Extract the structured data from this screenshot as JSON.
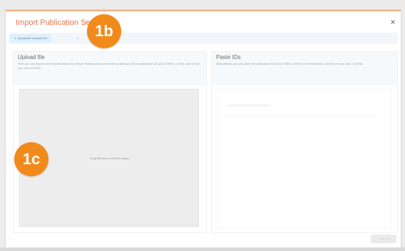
{
  "modal": {
    "title": "Import Publication Se",
    "close_label": "×",
    "steps": {
      "step1": "1. Upload file or paste IDs",
      "step2": "2."
    },
    "upload": {
      "title": "Upload file",
      "desc": "Here you can import a list of publications into Scival. Please upload a text file containing a list of publication IDs (DOI, PMID, or EID). (one ID per row, max. 50,000).",
      "dropzone_text": "Drop file here or click to upload"
    },
    "paste": {
      "title": "Paste IDs",
      "desc": "Alternatively, you can paste the publication IDs (DOI, PMID, or EID) in the field below. (one ID per row, max. 50,000)"
    },
    "footer_button": "Continue"
  },
  "badges": {
    "b": "1b",
    "c": "1c"
  },
  "colors": {
    "accent": "#e8744a",
    "badge": "#f28a1b",
    "step_active": "#dfeffa"
  },
  "icons": {
    "close": "close-icon"
  }
}
